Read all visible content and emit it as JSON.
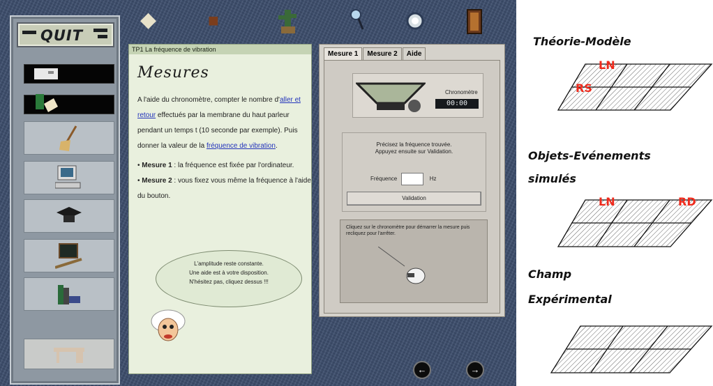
{
  "app": {
    "quit_label": "QUIT",
    "toolbar": [
      {
        "name": "notepad-icon",
        "glyph": "◆"
      },
      {
        "name": "book-icon",
        "glyph": "📕"
      },
      {
        "name": "cactus-icon",
        "glyph": "🌵"
      },
      {
        "name": "magnifier-icon",
        "glyph": "🔍"
      },
      {
        "name": "clock-icon",
        "glyph": "◔"
      },
      {
        "name": "door-icon",
        "glyph": "🚪"
      }
    ],
    "sidebar": [
      {
        "name": "scanner-icon",
        "glyph": "🖨"
      },
      {
        "name": "documents-icon",
        "glyph": "📄"
      },
      {
        "name": "broom-icon",
        "glyph": "🧹"
      },
      {
        "name": "computer-icon",
        "glyph": "🖥"
      },
      {
        "name": "graduation-cap-icon",
        "glyph": "🎓"
      },
      {
        "name": "blackboard-icon",
        "glyph": "📋"
      },
      {
        "name": "books-icon",
        "glyph": "📚"
      },
      {
        "name": "desk-icon",
        "glyph": "🪑"
      }
    ]
  },
  "card": {
    "header": "TP1 La fréquence de vibration",
    "title": "Mesures",
    "p1": "A l'aide du chronomètre, compter le nombre d'",
    "link1": "aller et retour",
    "p2": " effectués par la membrane du haut parleur pendant un temps t (10 seconde par exemple). Puis donner la valeur de la ",
    "link2": "fréquence de vibration",
    "p3": ".",
    "m1_label": "Mesure 1",
    "m1_text": " : la fréquence est fixée par l'ordinateur.",
    "m2_label": "Mesure 2",
    "m2_text": " : vous fixez vous même la fréquence à l'aide du bouton.",
    "bubble_1": "L'amplitude reste constante.",
    "bubble_2": "Une aide est à votre disposition.",
    "bubble_3": "N'hésitez pas, cliquez dessus !!!"
  },
  "panel": {
    "tabs": [
      "Mesure 1",
      "Mesure 2",
      "Aide"
    ],
    "chrono_label": "Chronomètre",
    "chrono_time": "00:00",
    "instruction_1": "Précisez la fréquence trouvée.",
    "instruction_2": "Appuyez ensuite sur Validation.",
    "freq_label": "Fréquence",
    "freq_unit": "Hz",
    "validation": "Validation",
    "hint_text": "Cliquez sur le chronomètre pour démarrer la mesure puis recliquez pour l'arrêter."
  },
  "diagram": {
    "label_1": "Théorie-Modèle",
    "label_2a": "Objets-Evénements",
    "label_2b": "simulés",
    "label_3a": "Champ",
    "label_3b": "Expérimental",
    "codes": {
      "ln_top": "LN",
      "rs": "RS",
      "ln_mid": "LN",
      "rd": "RD"
    },
    "code_color": "#ef2a1c"
  }
}
